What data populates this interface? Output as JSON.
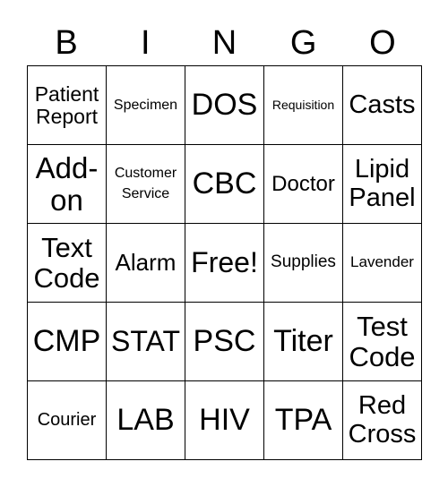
{
  "header": [
    "B",
    "I",
    "N",
    "G",
    "O"
  ],
  "rows": [
    [
      "Patient\nReport",
      "Specimen",
      "DOS",
      "Requisition",
      "Casts"
    ],
    [
      "Add-\non",
      "Customer\nService",
      "CBC",
      "Doctor",
      "Lipid\nPanel"
    ],
    [
      "Text\nCode",
      "Alarm",
      "Free!",
      "Supplies",
      "Lavender"
    ],
    [
      "CMP",
      "STAT",
      "PSC",
      "Titer",
      "Test\nCode"
    ],
    [
      "Courier",
      "LAB",
      "HIV",
      "TPA",
      "Red\nCross"
    ]
  ]
}
